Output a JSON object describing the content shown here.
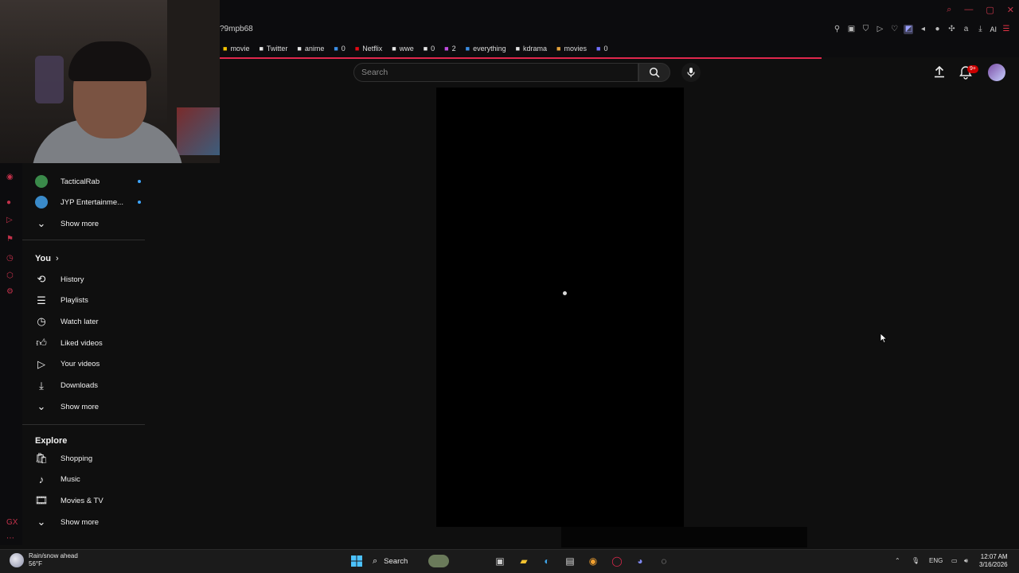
{
  "browser": {
    "url_fragment": "?9mpb68",
    "bookmarks": [
      {
        "icon": "play-icon",
        "label": "movie",
        "color": "#f5c400"
      },
      {
        "icon": "x-icon",
        "label": "Twitter",
        "color": "#e6e6e6"
      },
      {
        "icon": "anime-icon",
        "label": "anime",
        "color": "#e6e6e6"
      },
      {
        "icon": "folder-icon",
        "label": "0",
        "color": "#3b8ee5"
      },
      {
        "icon": "netflix-icon",
        "label": "Netflix",
        "color": "#e50914"
      },
      {
        "icon": "page-icon",
        "label": "wwe",
        "color": "#e6e6e6"
      },
      {
        "icon": "grid-icon",
        "label": "0",
        "color": "#e6e6e6"
      },
      {
        "icon": "diamond-icon",
        "label": "2",
        "color": "#c04de0"
      },
      {
        "icon": "one-icon",
        "label": "everything",
        "color": "#3b8ee5"
      },
      {
        "icon": "dots-icon",
        "label": "kdrama",
        "color": "#e6e6e6"
      },
      {
        "icon": "burger-icon",
        "label": "movies",
        "color": "#e6a43b"
      },
      {
        "icon": "tag-icon",
        "label": "0",
        "color": "#7070ff"
      }
    ],
    "ai_label": "AI"
  },
  "sidebar": {
    "subscriptions": [
      {
        "label": "TacticalRab",
        "avatar": "#3a8a4a",
        "new": true
      },
      {
        "label": "JYP Entertainme...",
        "avatar": "#3a8ac9",
        "new": true
      }
    ],
    "subs_show_more": "Show more",
    "you_title": "You",
    "you_items": [
      {
        "icon": "history-icon",
        "glyph": "⟲",
        "label": "History"
      },
      {
        "icon": "playlists-icon",
        "glyph": "☰",
        "label": "Playlists"
      },
      {
        "icon": "watch-later-icon",
        "glyph": "◷",
        "label": "Watch later"
      },
      {
        "icon": "thumbs-up-icon",
        "glyph": "👍︎",
        "label": "Liked videos"
      },
      {
        "icon": "your-videos-icon",
        "glyph": "▷",
        "label": "Your videos"
      },
      {
        "icon": "download-icon",
        "glyph": "⤓",
        "label": "Downloads"
      }
    ],
    "you_show_more": "Show more",
    "explore_title": "Explore",
    "explore_items": [
      {
        "icon": "shopping-icon",
        "glyph": "🛍︎",
        "label": "Shopping"
      },
      {
        "icon": "music-icon",
        "glyph": "♪",
        "label": "Music"
      },
      {
        "icon": "movies-icon",
        "glyph": "🎞︎",
        "label": "Movies & TV"
      }
    ],
    "explore_show_more": "Show more"
  },
  "masthead": {
    "search_placeholder": "Search",
    "notification_badge": "9+"
  },
  "taskbar": {
    "weather_title": "Rain/snow ahead",
    "weather_temp": "56°F",
    "search_label": "Search",
    "language": "ENG",
    "time": "12:07 AM",
    "date": "3/16/2026"
  }
}
